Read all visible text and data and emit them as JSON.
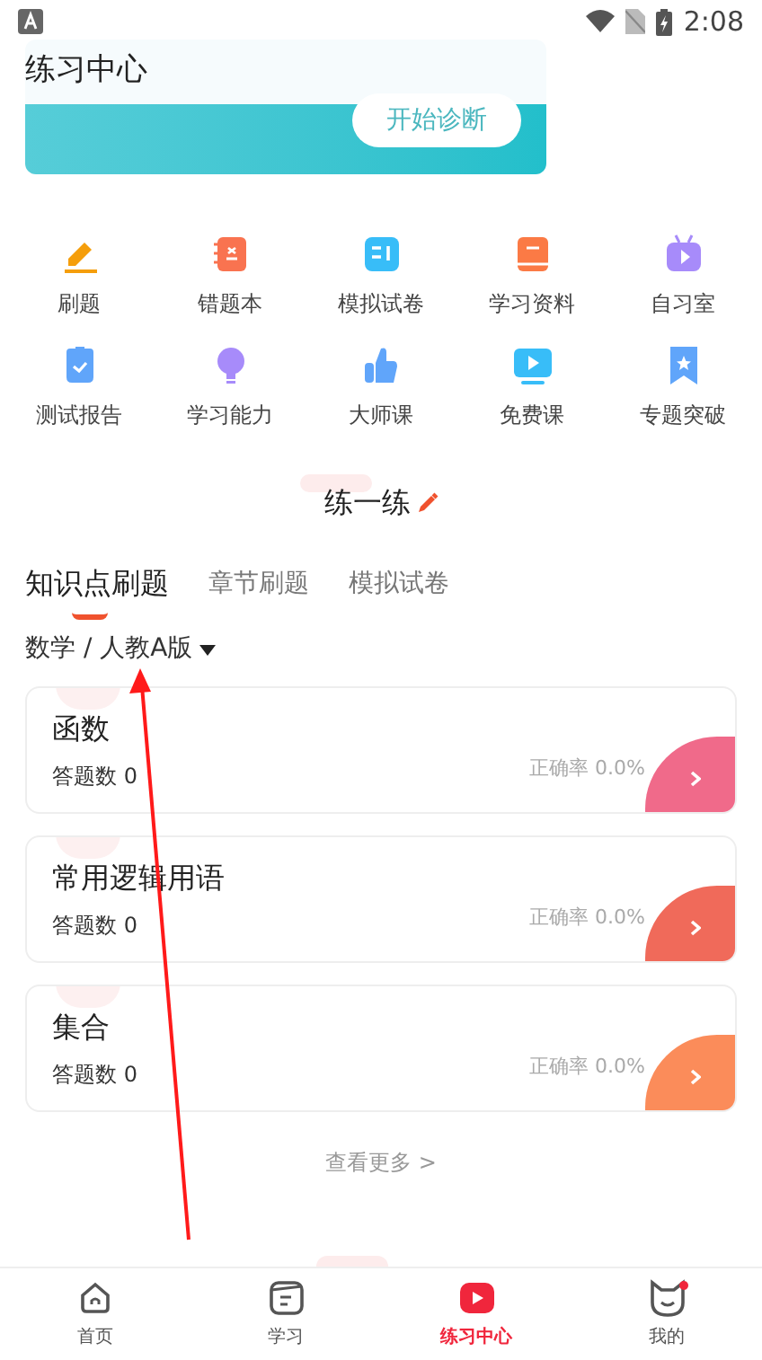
{
  "status_bar": {
    "time": "2:08"
  },
  "banner": {
    "title": "练习中心",
    "button": "开始诊断"
  },
  "shortcuts": [
    {
      "label": "刷题",
      "kind": "pencil"
    },
    {
      "label": "错题本",
      "kind": "notebook"
    },
    {
      "label": "模拟试卷",
      "kind": "paper"
    },
    {
      "label": "学习资料",
      "kind": "book"
    },
    {
      "label": "自习室",
      "kind": "tv"
    },
    {
      "label": "测试报告",
      "kind": "report"
    },
    {
      "label": "学习能力",
      "kind": "bulb"
    },
    {
      "label": "大师课",
      "kind": "thumb"
    },
    {
      "label": "免费课",
      "kind": "play"
    },
    {
      "label": "专题突破",
      "kind": "bookmark"
    }
  ],
  "section_title": "练一练",
  "tabs": [
    {
      "label": "知识点刷题",
      "selected": true
    },
    {
      "label": "章节刷题",
      "selected": false
    },
    {
      "label": "模拟试卷",
      "selected": false
    }
  ],
  "subject_selector": "数学 / 人教A版",
  "topics": [
    {
      "name": "函数",
      "answered": "答题数 0",
      "accuracy": "正确率 0.0%",
      "color": "#f06a8a"
    },
    {
      "name": "常用逻辑用语",
      "answered": "答题数 0",
      "accuracy": "正确率 0.0%",
      "color": "#f06a5a"
    },
    {
      "name": "集合",
      "answered": "答题数 0",
      "accuracy": "正确率 0.0%",
      "color": "#fb8c5a"
    }
  ],
  "more_link": "查看更多 >",
  "bottom_nav": [
    {
      "label": "首页",
      "kind": "home",
      "selected": false,
      "badge": false
    },
    {
      "label": "学习",
      "kind": "study",
      "selected": false,
      "badge": false
    },
    {
      "label": "练习中心",
      "kind": "practice",
      "selected": true,
      "badge": false
    },
    {
      "label": "我的",
      "kind": "cat",
      "selected": false,
      "badge": true
    }
  ]
}
